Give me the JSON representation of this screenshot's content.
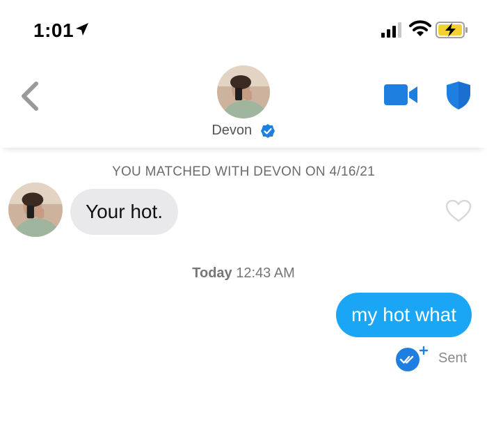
{
  "status_bar": {
    "time": "1:01"
  },
  "header": {
    "name": "Devon"
  },
  "conversation": {
    "match_banner": "YOU MATCHED WITH DEVON ON 4/16/21",
    "incoming_message": "Your hot.",
    "timestamp_day": "Today",
    "timestamp_time": "12:43 AM",
    "outgoing_message": "my hot what",
    "status": "Sent"
  },
  "colors": {
    "accent": "#1aa6f4",
    "shield": "#1f7fe0",
    "incoming_bubble": "#e9e9eb"
  },
  "icons": [
    "location-arrow-icon",
    "signal-icon",
    "wifi-icon",
    "battery-charging-icon",
    "back-chevron-icon",
    "verified-badge-icon",
    "video-call-icon",
    "safety-shield-icon",
    "heart-icon",
    "read-receipt-icon"
  ]
}
